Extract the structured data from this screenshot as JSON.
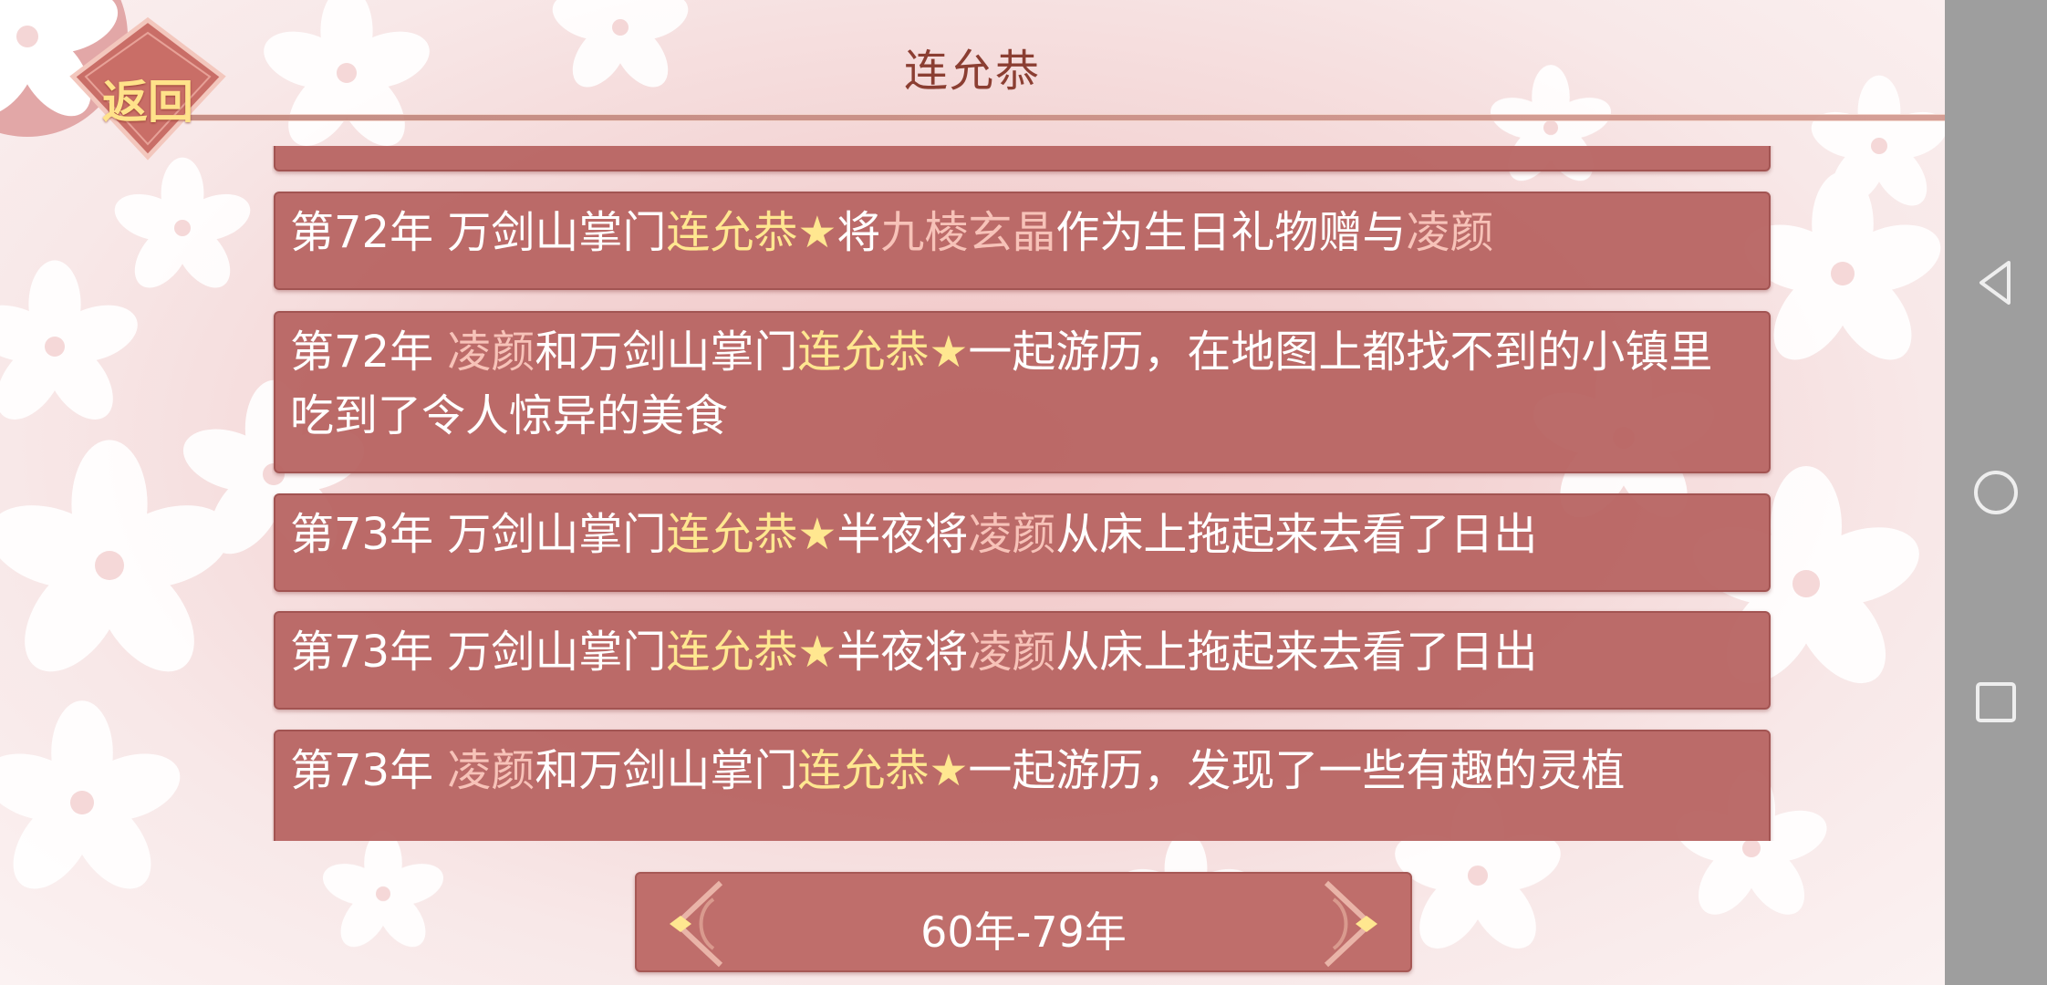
{
  "header": {
    "title": "连允恭",
    "back_label": "返回"
  },
  "colors": {
    "entry_bg": "#b76462",
    "npc_name": "#ffe790",
    "player_name": "#f7c2b8",
    "title_text": "#8b3e32",
    "back_label": "#ffe28a"
  },
  "entries": [
    {
      "segments": [
        {
          "text": "第72年 万剑山掌门",
          "kind": "plain"
        },
        {
          "text": "连允恭",
          "kind": "npc"
        },
        {
          "text": "★",
          "kind": "star"
        },
        {
          "text": "将",
          "kind": "plain"
        },
        {
          "text": "九棱玄晶",
          "kind": "item"
        },
        {
          "text": "作为生日礼物赠与",
          "kind": "plain"
        },
        {
          "text": "凌颜",
          "kind": "pc"
        }
      ]
    },
    {
      "segments": [
        {
          "text": "第72年 ",
          "kind": "plain"
        },
        {
          "text": "凌颜",
          "kind": "pc"
        },
        {
          "text": "和万剑山掌门",
          "kind": "plain"
        },
        {
          "text": "连允恭",
          "kind": "npc"
        },
        {
          "text": "★",
          "kind": "star"
        },
        {
          "text": "一起游历，在地图上都找不到的小镇里吃到了令人惊异的美食",
          "kind": "plain"
        }
      ]
    },
    {
      "segments": [
        {
          "text": "第73年 万剑山掌门",
          "kind": "plain"
        },
        {
          "text": "连允恭",
          "kind": "npc"
        },
        {
          "text": "★",
          "kind": "star"
        },
        {
          "text": "半夜将",
          "kind": "plain"
        },
        {
          "text": "凌颜",
          "kind": "pc"
        },
        {
          "text": "从床上拖起来去看了日出",
          "kind": "plain"
        }
      ]
    },
    {
      "segments": [
        {
          "text": "第73年 万剑山掌门",
          "kind": "plain"
        },
        {
          "text": "连允恭",
          "kind": "npc"
        },
        {
          "text": "★",
          "kind": "star"
        },
        {
          "text": "半夜将",
          "kind": "plain"
        },
        {
          "text": "凌颜",
          "kind": "pc"
        },
        {
          "text": "从床上拖起来去看了日出",
          "kind": "plain"
        }
      ]
    },
    {
      "segments": [
        {
          "text": "第73年 ",
          "kind": "plain"
        },
        {
          "text": "凌颜",
          "kind": "pc"
        },
        {
          "text": "和万剑山掌门",
          "kind": "plain"
        },
        {
          "text": "连允恭",
          "kind": "npc"
        },
        {
          "text": "★",
          "kind": "star"
        },
        {
          "text": "一起游历，发现了一些有趣的灵植",
          "kind": "plain"
        }
      ]
    }
  ],
  "pager": {
    "era_label": "60年-79年",
    "prev_icon": "ornate-left-arrow-icon",
    "next_icon": "ornate-right-arrow-icon"
  },
  "nav": {
    "back_icon": "triangle-back-icon",
    "home_icon": "circle-home-icon",
    "recents_icon": "square-recents-icon"
  }
}
